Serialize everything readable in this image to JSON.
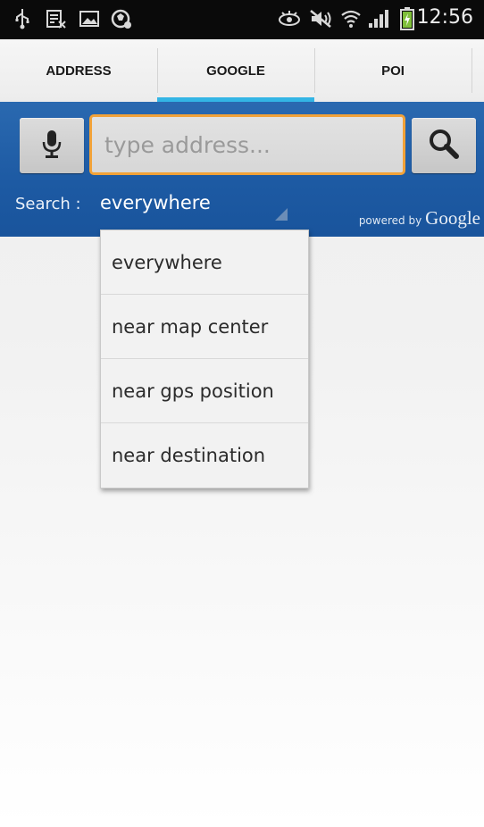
{
  "status_bar": {
    "time": "12:56",
    "icons": [
      "usb-icon",
      "sd-card-icon",
      "image-icon",
      "sync-icon",
      "eye-icon",
      "mute-icon",
      "wifi-icon",
      "signal-icon",
      "battery-icon"
    ]
  },
  "tabs": [
    {
      "label": "ADDRESS",
      "active": false
    },
    {
      "label": "GOOGLE",
      "active": true
    },
    {
      "label": "POI",
      "active": false
    }
  ],
  "search": {
    "placeholder": "type address...",
    "value": "",
    "mic_icon": "microphone-icon",
    "search_icon": "magnifier-icon",
    "scope_label": "Search :",
    "scope_value": "everywhere",
    "powered_by": "powered by",
    "provider": "Google"
  },
  "dropdown": {
    "options": [
      "everywhere",
      "near map center",
      "near gps position",
      "near destination"
    ]
  },
  "colors": {
    "panel_blue": "#1d5aa3",
    "tab_indicator": "#33b5e5",
    "input_focus": "#f2a238"
  }
}
